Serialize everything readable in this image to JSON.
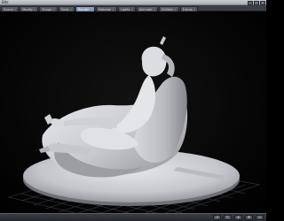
{
  "window": {
    "title": "Bltz"
  },
  "tabs": [
    {
      "label": "Scene",
      "active": false
    },
    {
      "label": "Modify",
      "active": false
    },
    {
      "label": "Shape",
      "active": false
    },
    {
      "label": "Tools",
      "active": false
    },
    {
      "label": "Render",
      "active": true
    },
    {
      "label": "Material",
      "active": false
    },
    {
      "label": "Lights",
      "active": false
    },
    {
      "label": "Animate",
      "active": false
    },
    {
      "label": "Utilities",
      "active": false
    },
    {
      "label": "Extras",
      "active": false
    }
  ],
  "window_controls": {
    "minimize": "–",
    "maximize": "□",
    "close": "×"
  },
  "viewport": {
    "background": "#000000",
    "grid_color": "#3a3d44",
    "model_color": "#d3d4d8"
  },
  "statusbar": {
    "buttons": [
      {
        "icon": "undo-icon",
        "glyph": "↺"
      },
      {
        "icon": "redo-icon",
        "glyph": "↻"
      },
      {
        "icon": "zoom-icon",
        "glyph": "⊕"
      },
      {
        "icon": "pan-icon",
        "glyph": "✥"
      },
      {
        "icon": "orbit-icon",
        "glyph": "⟲"
      }
    ]
  }
}
